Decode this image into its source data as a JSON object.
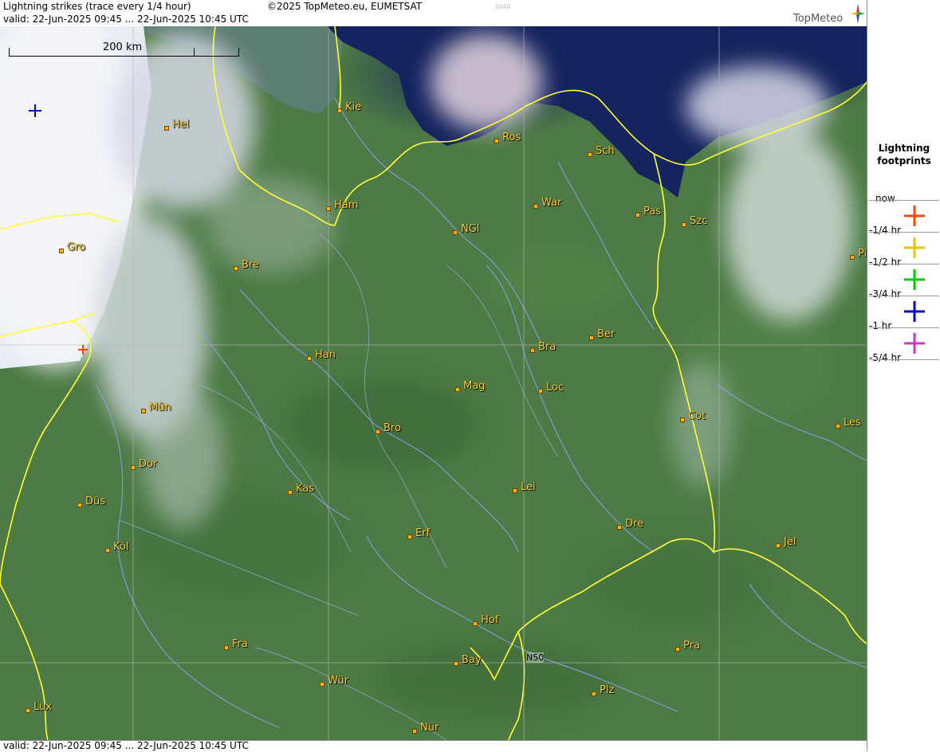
{
  "header": {
    "title": "Lightning strikes (trace every 1/4 hour)",
    "copyright": "©2025 TopMeteo.eu, EUMETSAT",
    "tiny_code": "3040",
    "valid": "valid:  22-Jun-2025 09:45 ... 22-Jun-2025 10:45 UTC",
    "logo": "TopMeteo"
  },
  "footer": {
    "valid": "valid:  22-Jun-2025 09:45 ... 22-Jun-2025 10:45 UTC"
  },
  "scale": {
    "label": "200 km"
  },
  "grid": {
    "lat_label": "N50"
  },
  "legend": {
    "title": "Lightning\nfootprints",
    "items": [
      {
        "label": "now",
        "color": "#ff4500"
      },
      {
        "label": "-1/4 hr",
        "color": "#e0c800"
      },
      {
        "label": "-1/2 hr",
        "color": "#00cc00"
      },
      {
        "label": "-3/4 hr",
        "color": "#0000dd"
      },
      {
        "label": "-1 hr",
        "color": "#cc33cc"
      },
      {
        "label": "-5/4 hr",
        "color": ""
      }
    ]
  },
  "cities": [
    {
      "name": "Kie"
    },
    {
      "name": "Hel"
    },
    {
      "name": "Ros"
    },
    {
      "name": "Sch"
    },
    {
      "name": "Ham"
    },
    {
      "name": "War"
    },
    {
      "name": "Pas"
    },
    {
      "name": "Szc"
    },
    {
      "name": "NGl"
    },
    {
      "name": "Gro"
    },
    {
      "name": "Bre"
    },
    {
      "name": "Pi"
    },
    {
      "name": "Ber"
    },
    {
      "name": "Han"
    },
    {
      "name": "Bra"
    },
    {
      "name": "Mag"
    },
    {
      "name": "Loc"
    },
    {
      "name": "Mün"
    },
    {
      "name": "Cot"
    },
    {
      "name": "Les"
    },
    {
      "name": "Bro"
    },
    {
      "name": "Dor"
    },
    {
      "name": "Kas"
    },
    {
      "name": "Lei"
    },
    {
      "name": "Düs"
    },
    {
      "name": "Dre"
    },
    {
      "name": "Erf"
    },
    {
      "name": "Köl"
    },
    {
      "name": "Jel"
    },
    {
      "name": "Hof"
    },
    {
      "name": "Fra"
    },
    {
      "name": "Pra"
    },
    {
      "name": "Bay"
    },
    {
      "name": "Wür"
    },
    {
      "name": "Plz"
    },
    {
      "name": "Lux"
    },
    {
      "name": "Nür"
    }
  ],
  "strikes": [
    {
      "age": "-3/4 hr",
      "color": "#0000dd"
    },
    {
      "age": "now",
      "color": "#ff4500"
    }
  ]
}
